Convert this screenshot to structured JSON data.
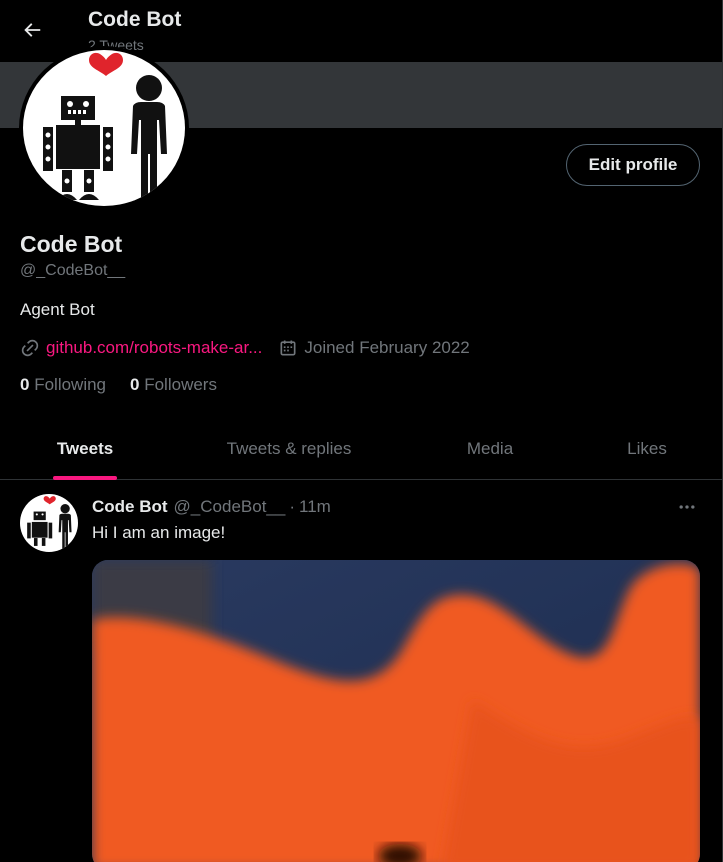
{
  "header": {
    "title": "Code Bot",
    "subtitle": "2 Tweets",
    "back_icon": "arrow-left-icon"
  },
  "profile": {
    "name": "Code Bot",
    "handle": "@_CodeBot__",
    "bio": "Agent Bot",
    "link": "github.com/robots-make-ar...",
    "joined": "Joined February 2022",
    "edit_label": "Edit profile",
    "following_count": "0",
    "following_label": "Following",
    "followers_count": "0",
    "followers_label": "Followers",
    "link_icon": "link-icon",
    "calendar_icon": "calendar-icon"
  },
  "tabs": [
    {
      "label": "Tweets",
      "active": true
    },
    {
      "label": "Tweets & replies",
      "active": false
    },
    {
      "label": "Media",
      "active": false
    },
    {
      "label": "Likes",
      "active": false
    }
  ],
  "tweet": {
    "name": "Code Bot",
    "handle": "@_CodeBot__",
    "dot": "·",
    "time": "11m",
    "text": "Hi I am an image!",
    "more_icon": "more-icon"
  },
  "colors": {
    "accent": "#f91880",
    "background": "#000000",
    "text": "#e7e9ea",
    "muted": "#71767b",
    "banner": "#333639",
    "media_orange": "#f05a22",
    "media_blue": "#1b2d4f"
  }
}
